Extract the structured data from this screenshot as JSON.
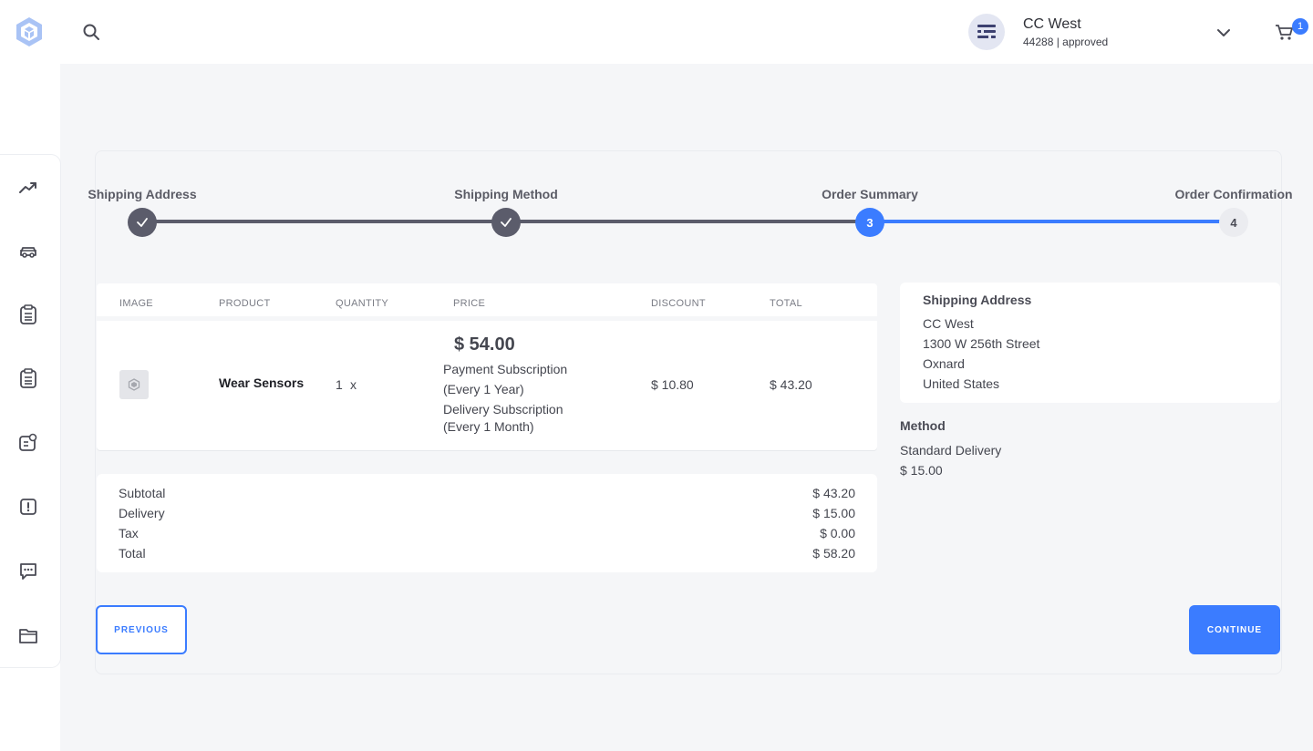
{
  "header": {
    "user_name": "CC West",
    "user_sub": "44288 | approved",
    "cart_count": "1"
  },
  "icons": {
    "logo": "cube-logo-icon",
    "search": "search-icon",
    "avatar": "store-avatar-icon",
    "dropdown": "chevron-down-icon",
    "cart": "cart-icon",
    "rail": [
      "trending-up-icon",
      "car-icon",
      "clipboard-icon",
      "clipboard-list-icon",
      "profile-card-icon",
      "alert-icon",
      "chat-icon",
      "folder-icon"
    ]
  },
  "stepper": {
    "steps": [
      {
        "label": "Shipping Address",
        "state": "done"
      },
      {
        "label": "Shipping Method",
        "state": "done"
      },
      {
        "label": "Order Summary",
        "state": "active",
        "number": "3"
      },
      {
        "label": "Order Confirmation",
        "state": "pending",
        "number": "4"
      }
    ],
    "colors": {
      "done": "#5b5c6b",
      "active": "#3b7cff",
      "pending": "#ebecf0"
    }
  },
  "table": {
    "headers": [
      "IMAGE",
      "PRODUCT",
      "QUANTITY",
      "PRICE",
      "DISCOUNT",
      "TOTAL"
    ],
    "row": {
      "product": "Wear Sensors",
      "quantity": "1",
      "quantity_sep": "x",
      "price": "$ 54.00",
      "payment_sub": "Payment Subscription",
      "payment_period": "(Every 1 Year)",
      "delivery_sub": "Delivery Subscription",
      "delivery_period": "(Every 1 Month)",
      "discount": "$ 10.80",
      "total": "$ 43.20"
    }
  },
  "totals": [
    {
      "label": "Subtotal",
      "value": "$ 43.20"
    },
    {
      "label": "Delivery",
      "value": "$ 15.00"
    },
    {
      "label": "Tax",
      "value": "$ 0.00"
    },
    {
      "label": "Total",
      "value": "$ 58.20"
    }
  ],
  "shipping": {
    "title": "Shipping Address",
    "lines": [
      "CC West",
      "1300 W 256th Street",
      "Oxnard",
      "United States"
    ]
  },
  "method": {
    "title": "Method",
    "name": "Standard Delivery",
    "price": "$ 15.00"
  },
  "buttons": {
    "previous": "PREVIOUS",
    "continue": "CONTINUE"
  },
  "accent_color": "#3b7cff"
}
